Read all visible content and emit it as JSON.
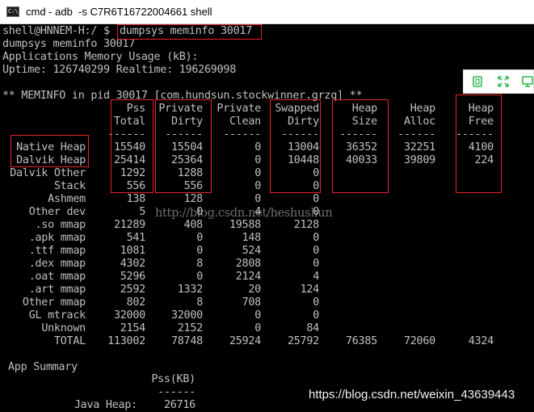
{
  "window": {
    "title": "cmd - adb  -s C7R6T16722004661 shell",
    "icon_label": "C:\\."
  },
  "terminal": {
    "prompt": "shell@HNNEM-H:/ $ ",
    "command": "dumpsys meminfo 30017",
    "echo": "dumpsys meminfo 30017",
    "usage_title": "Applications Memory Usage (kB):",
    "uptime": "Uptime: 126740299 Realtime: 196269098",
    "meminfo_header": "** MEMINFO in pid 30017 [com.hundsun.stockwinner.grzq] **",
    "columns": [
      {
        "line1": "Pss",
        "line2": "Total"
      },
      {
        "line1": "Private",
        "line2": "Dirty"
      },
      {
        "line1": "Private",
        "line2": "Clean"
      },
      {
        "line1": "Swapped",
        "line2": "Dirty"
      },
      {
        "line1": "Heap",
        "line2": "Size"
      },
      {
        "line1": "Heap",
        "line2": "Alloc"
      },
      {
        "line1": "Heap",
        "line2": "Free"
      }
    ],
    "separator": "------",
    "rows": [
      {
        "label": "Native Heap",
        "values": [
          "15540",
          "15504",
          "0",
          "13004",
          "36352",
          "32251",
          "4100"
        ]
      },
      {
        "label": "Dalvik Heap",
        "values": [
          "25414",
          "25364",
          "0",
          "10448",
          "40033",
          "39809",
          "224"
        ]
      },
      {
        "label": "Dalvik Other",
        "values": [
          "1292",
          "1288",
          "0",
          "0",
          "",
          "",
          ""
        ]
      },
      {
        "label": "Stack",
        "values": [
          "556",
          "556",
          "0",
          "0",
          "",
          "",
          ""
        ]
      },
      {
        "label": "Ashmem",
        "values": [
          "138",
          "128",
          "0",
          "0",
          "",
          "",
          ""
        ]
      },
      {
        "label": "Other dev",
        "values": [
          "5",
          "0",
          "4",
          "0",
          "",
          "",
          ""
        ]
      },
      {
        "label": ".so mmap",
        "values": [
          "21289",
          "408",
          "19588",
          "2128",
          "",
          "",
          ""
        ]
      },
      {
        "label": ".apk mmap",
        "values": [
          "541",
          "0",
          "148",
          "0",
          "",
          "",
          ""
        ]
      },
      {
        "label": ".ttf mmap",
        "values": [
          "1081",
          "0",
          "524",
          "0",
          "",
          "",
          ""
        ]
      },
      {
        "label": ".dex mmap",
        "values": [
          "4302",
          "8",
          "2808",
          "0",
          "",
          "",
          ""
        ]
      },
      {
        "label": ".oat mmap",
        "values": [
          "5296",
          "0",
          "2124",
          "4",
          "",
          "",
          ""
        ]
      },
      {
        "label": ".art mmap",
        "values": [
          "2592",
          "1332",
          "20",
          "124",
          "",
          "",
          ""
        ]
      },
      {
        "label": "Other mmap",
        "values": [
          "802",
          "8",
          "708",
          "0",
          "",
          "",
          ""
        ]
      },
      {
        "label": "GL mtrack",
        "values": [
          "32000",
          "32000",
          "0",
          "0",
          "",
          "",
          ""
        ]
      },
      {
        "label": "Unknown",
        "values": [
          "2154",
          "2152",
          "0",
          "84",
          "",
          "",
          ""
        ]
      },
      {
        "label": "TOTAL",
        "values": [
          "113002",
          "78748",
          "25924",
          "25792",
          "76385",
          "72060",
          "4324"
        ]
      }
    ],
    "app_summary": {
      "title": "App Summary",
      "column": "Pss(KB)",
      "separator": "------",
      "rows": [
        {
          "label": "Java Heap:",
          "value": "26716"
        }
      ]
    }
  },
  "watermarks": {
    "center": "http://blog.csdn.net/heshushun",
    "bottom": "https://blog.csdn.net/weixin_43639443"
  },
  "floating_toolbar": {
    "icons": [
      "copy-icon",
      "expand-icon",
      "screen-icon"
    ]
  },
  "colors": {
    "terminal_bg": "#000000",
    "terminal_text": "#c0c0c0",
    "highlight": "#e8202a",
    "toolbar_icon": "#2db84d"
  }
}
